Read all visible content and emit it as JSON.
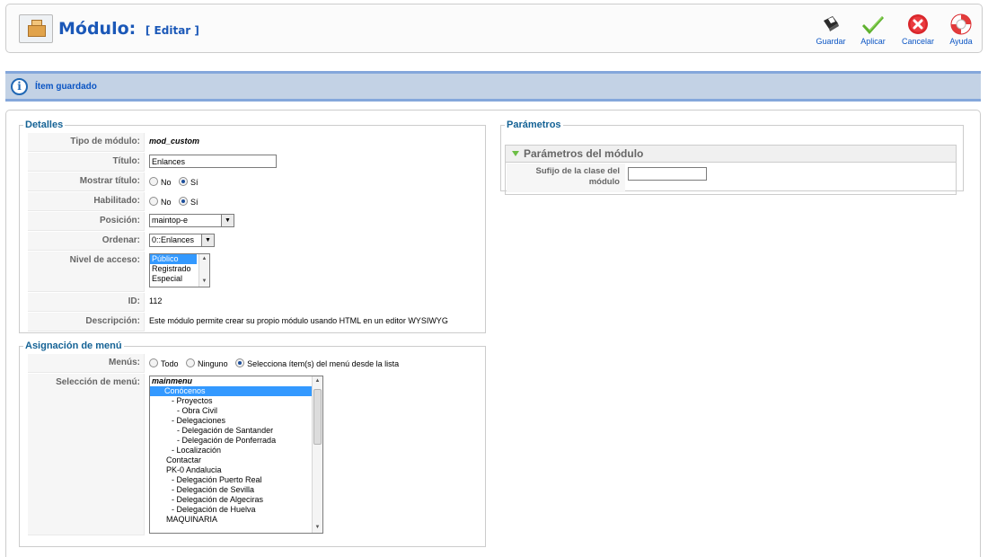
{
  "header": {
    "title": "Módulo:",
    "subtitle": "[ Editar ]",
    "buttons": {
      "save": "Guardar",
      "apply": "Aplicar",
      "cancel": "Cancelar",
      "help": "Ayuda"
    }
  },
  "message": {
    "icon": "info-icon",
    "text": "Ítem guardado"
  },
  "details": {
    "legend": "Detalles",
    "module_type_label": "Tipo de módulo:",
    "module_type_value": "mod_custom",
    "title_label": "Título:",
    "title_value": "Enlances",
    "show_title_label": "Mostrar título:",
    "enabled_label": "Habilitado:",
    "no_label": "No",
    "yes_label": "Sí",
    "position_label": "Posición:",
    "position_value": "maintop-e",
    "order_label": "Ordenar:",
    "order_value": "0::Enlances",
    "access_label": "Nivel de acceso:",
    "access_options": [
      "Público",
      "Registrado",
      "Especial"
    ],
    "id_label": "ID:",
    "id_value": "112",
    "description_label": "Descripción:",
    "description_value": "Este módulo permite crear su propio módulo usando HTML en un editor WYSIWYG"
  },
  "menu_assignment": {
    "legend": "Asignación de menú",
    "menus_label": "Menús:",
    "option_all": "Todo",
    "option_none": "Ninguno",
    "option_select": "Selecciona ítem(s) del menú desde la lista",
    "selection_label": "Selección de menú:",
    "items": [
      "mainmenu",
      "Conócenos",
      "- Proyectos",
      "- Obra Civil",
      "- Delegaciones",
      "- Delegación de Santander",
      "- Delegación de Ponferrada",
      "- Localización",
      "Contactar",
      "PK-0 Andalucia",
      "- Delegación Puerto Real",
      "- Delegación de Sevilla",
      "- Delegación de Algeciras",
      "- Delegación de Huelva",
      "MAQUINARIA"
    ]
  },
  "parameters": {
    "legend": "Parámetros",
    "pane_title": "Parámetros del módulo",
    "suffix_label_1": "Sufijo de la clase del",
    "suffix_label_2": "módulo",
    "suffix_value": ""
  },
  "colors": {
    "title_blue": "#1b58b8",
    "message_bg": "#c3d2e5",
    "selection_blue": "#3399ff",
    "legend_blue": "#146295"
  }
}
